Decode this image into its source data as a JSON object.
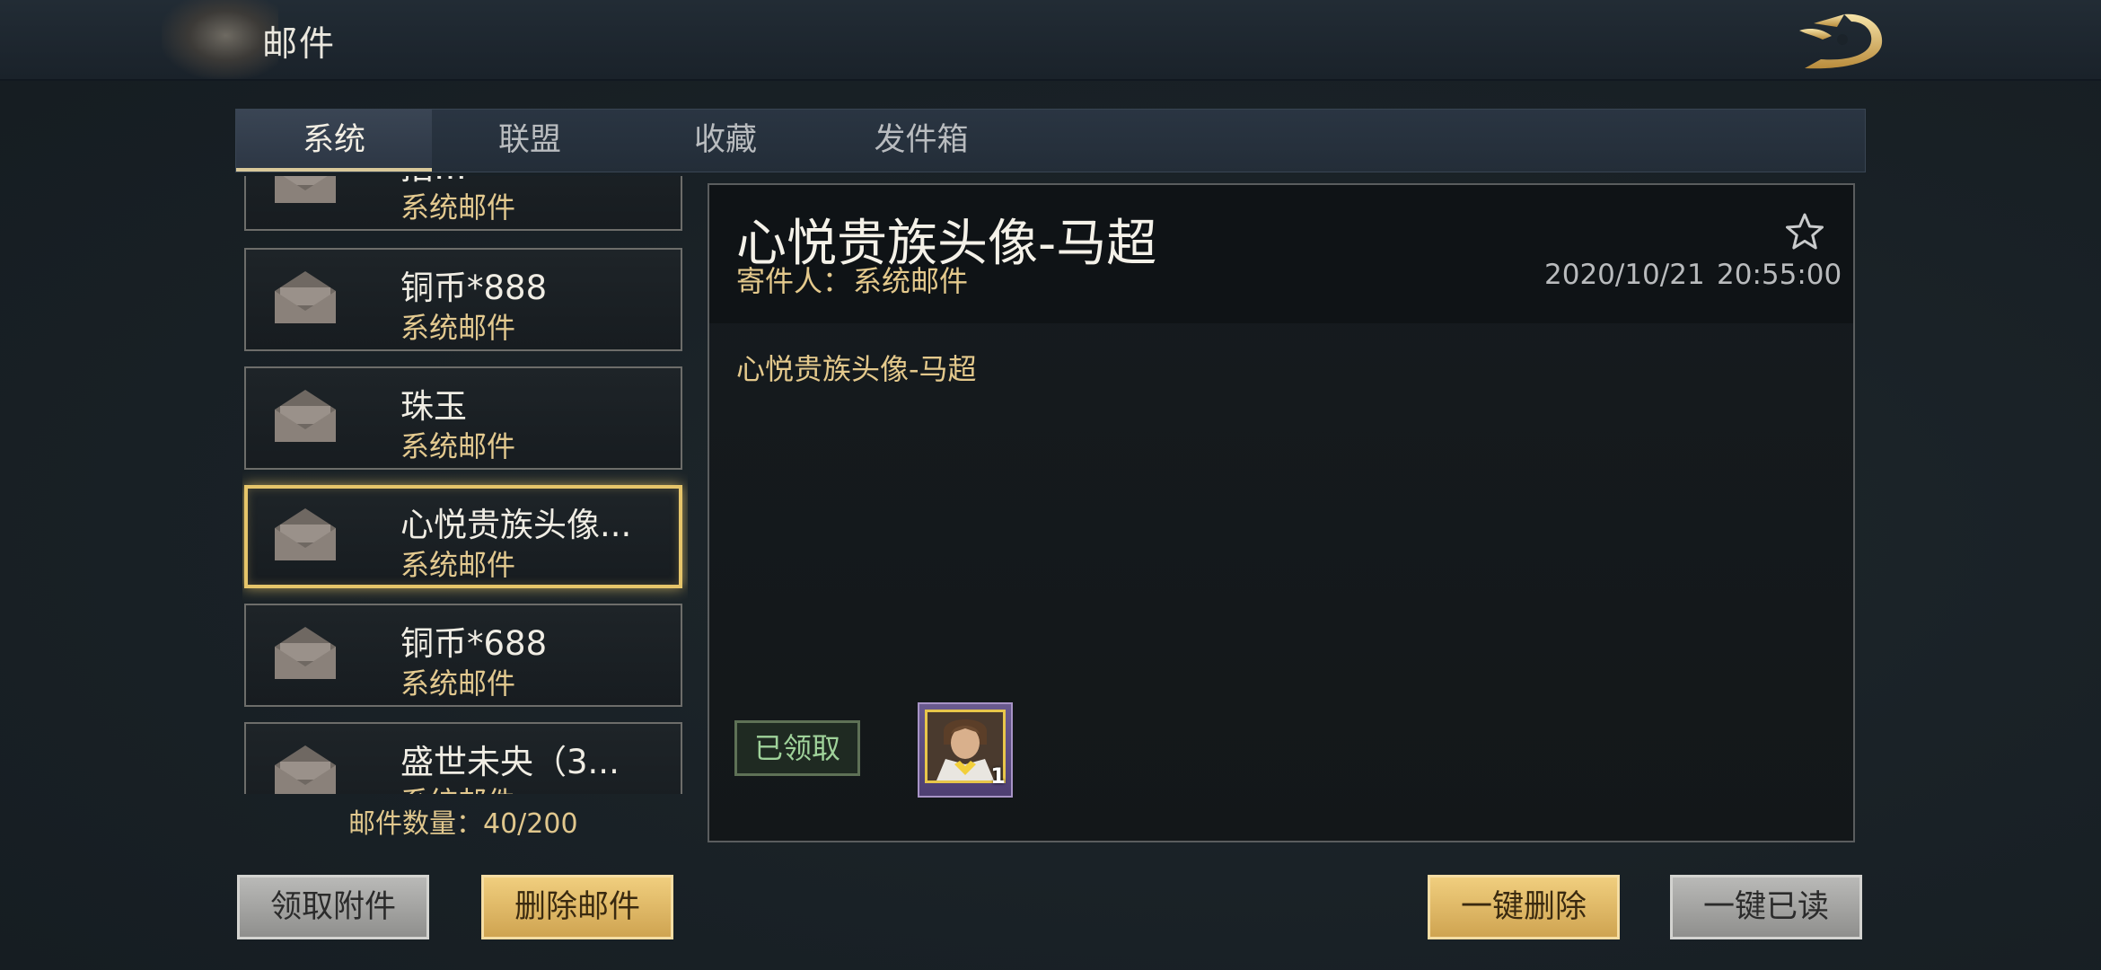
{
  "header": {
    "title": "邮件"
  },
  "tabs": [
    {
      "label": "系统",
      "active": true
    },
    {
      "label": "联盟",
      "active": false
    },
    {
      "label": "收藏",
      "active": false
    },
    {
      "label": "发件箱",
      "active": false
    }
  ],
  "mails": [
    {
      "title": "招…",
      "sender": "系统邮件"
    },
    {
      "title": "铜币*888",
      "sender": "系统邮件"
    },
    {
      "title": "珠玉",
      "sender": "系统邮件"
    },
    {
      "title": "心悦贵族头像...",
      "sender": "系统邮件",
      "selected": true
    },
    {
      "title": "铜币*688",
      "sender": "系统邮件"
    },
    {
      "title": "盛世未央（3...",
      "sender": "系统邮件"
    }
  ],
  "mail_count": {
    "label": "邮件数量：",
    "value": "40/200"
  },
  "detail": {
    "title": "心悦贵族头像-马超",
    "sender_label": "寄件人：",
    "sender": "系统邮件",
    "date": "2020/10/21",
    "time": "20:55:00",
    "body": "心悦贵族头像-马超",
    "claimed_label": "已领取",
    "reward_count": "1"
  },
  "buttons": {
    "claim": "领取附件",
    "delete": "删除邮件",
    "delete_all": "一键删除",
    "read_all": "一键已读"
  },
  "colors": {
    "accent_gold": "#e6c56a",
    "sender_gold": "#e4c98c",
    "claimed_green": "#9fd29a"
  }
}
